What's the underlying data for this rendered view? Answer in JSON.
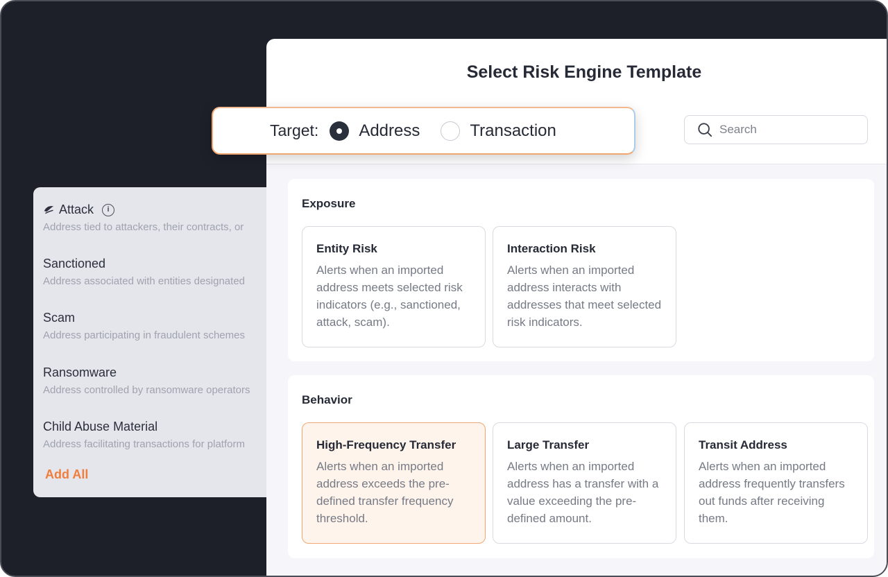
{
  "indicators": {
    "items": [
      {
        "title": "Attack",
        "desc": "Address tied to attackers, their contracts, or"
      },
      {
        "title": "Sanctioned",
        "desc": "Address associated with entities designated"
      },
      {
        "title": "Scam",
        "desc": "Address participating in fraudulent schemes"
      },
      {
        "title": "Ransomware",
        "desc": "Address controlled by ransomware operators"
      },
      {
        "title": "Child Abuse Material",
        "desc": "Address facilitating transactions for platform"
      }
    ],
    "add_all_label": "Add All",
    "info_glyph": "i"
  },
  "modal": {
    "title": "Select Risk Engine Template",
    "search": {
      "placeholder": "Search"
    }
  },
  "target": {
    "label": "Target:",
    "options": [
      {
        "label": "Address",
        "selected": true
      },
      {
        "label": "Transaction",
        "selected": false
      }
    ]
  },
  "sections": [
    {
      "title": "Exposure",
      "cards": [
        {
          "title": "Entity Risk",
          "desc": "Alerts when an imported address meets selected risk indicators (e.g., sanctioned, attack, scam)."
        },
        {
          "title": "Interaction Risk",
          "desc": "Alerts when an imported address interacts with addresses that meet selected risk indicators."
        }
      ]
    },
    {
      "title": "Behavior",
      "cards": [
        {
          "title": "High-Frequency Transfer",
          "desc": "Alerts when an imported address exceeds the pre-defined transfer frequency threshold.",
          "selected": true
        },
        {
          "title": "Large Transfer",
          "desc": "Alerts when an imported address has a transfer with a value exceeding the pre-defined amount."
        },
        {
          "title": "Transit Address",
          "desc": "Alerts when an imported address frequently transfers out funds after receiving them."
        }
      ]
    }
  ],
  "colors": {
    "accent": "#ef7d3c",
    "frame": "#1d2029",
    "selected_card_bg": "#fff4ec"
  },
  "icons": [
    "attack-icon",
    "info-icon",
    "search-icon",
    "radio-selected-icon",
    "radio-unselected-icon"
  ]
}
